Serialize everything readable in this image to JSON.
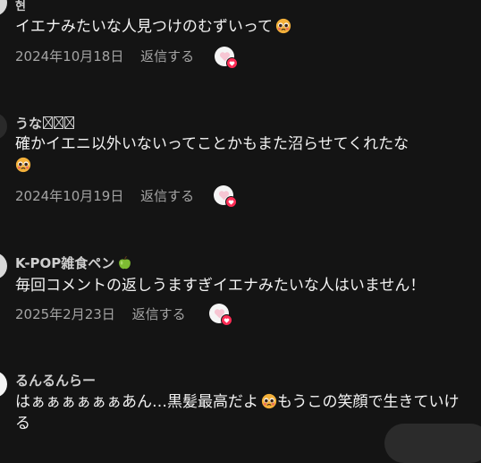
{
  "comments": [
    {
      "author": "현",
      "text": "イエナみたいな人見つけのむずいって",
      "emoji": "pleading-face-icon",
      "date": "2024年10月18日",
      "reply_label": "返信する"
    },
    {
      "author": "うな",
      "text": "確かイエニ以外いないってことかもまた沼らせてくれたな",
      "emoji": "pleading-face-icon",
      "date": "2024年10月19日",
      "reply_label": "返信する"
    },
    {
      "author": "K-POP雑食ペン",
      "author_emoji": "green-apple-icon",
      "text": "毎回コメントの返しうますぎイエナみたいな人はいません！",
      "date": "2025年2月23日",
      "reply_label": "返信する"
    },
    {
      "author": "るんるんらー",
      "text_before": "はぁぁぁぁぁぁあん…黒髪最高だよ",
      "emoji": "pleading-face-icon",
      "text_after": "もうこの笑顔で生きていける"
    }
  ],
  "colors": {
    "background": "#141414",
    "badge": "#fe2c55",
    "meta": "#a4a4a4"
  }
}
